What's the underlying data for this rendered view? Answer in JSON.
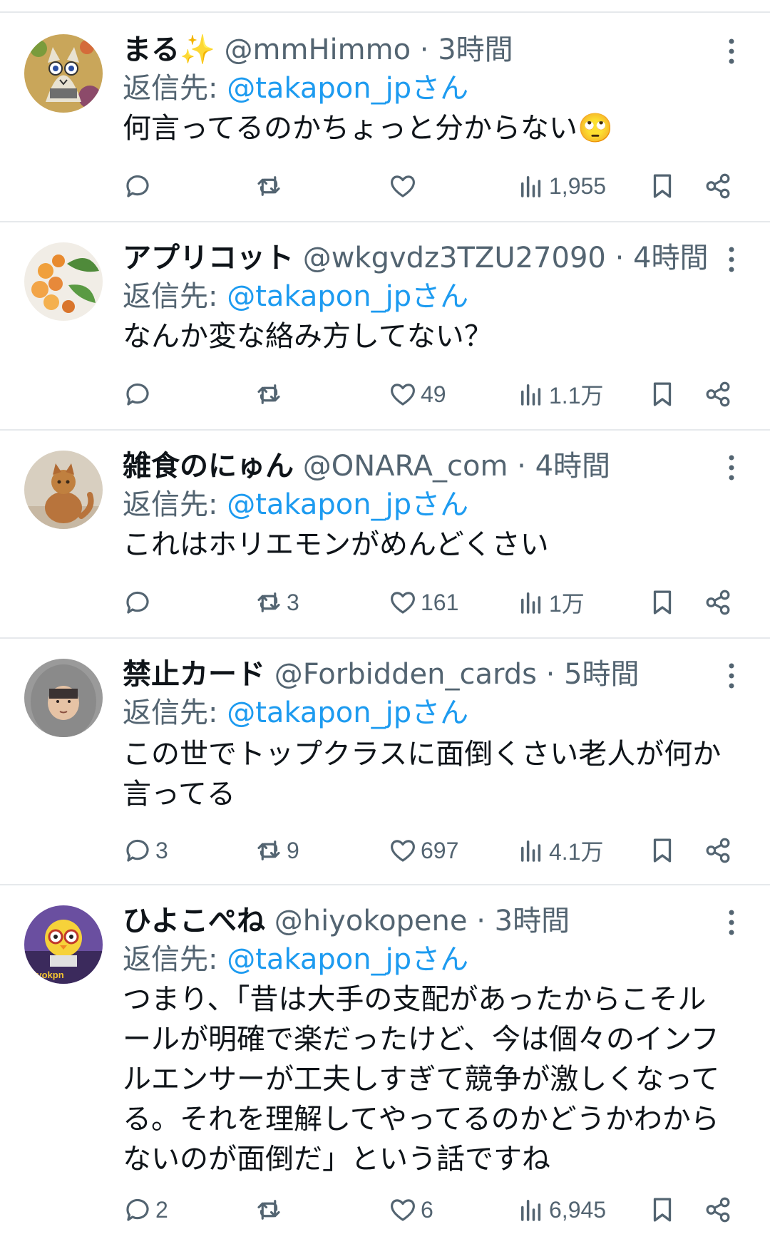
{
  "tweets": [
    {
      "name": "まる✨",
      "handle": "@mmHimmo",
      "sep": " · ",
      "time": "3時間",
      "reply_prefix": "返信先: ",
      "reply_target": "@takapon_jpさん",
      "text": "何言ってるのかちょっと分からない🙄",
      "replies": "",
      "retweets": "",
      "likes": "",
      "views": "1,955",
      "avatar": "cat-illustration-avatar"
    },
    {
      "name": "アプリコット",
      "handle": "@wkgvdz3TZU27090",
      "sep": " · ",
      "time": "4時間",
      "reply_prefix": "返信先: ",
      "reply_target": "@takapon_jpさん",
      "text": "なんか変な絡み方してない？",
      "replies": "",
      "retweets": "",
      "likes": "49",
      "views": "1.1万",
      "avatar": "apricot-photo-avatar"
    },
    {
      "name": "雑食のにゅん",
      "handle": "@ONARA_com",
      "sep": " · ",
      "time": "4時間",
      "reply_prefix": "返信先: ",
      "reply_target": "@takapon_jpさん",
      "text": "これはホリエモンがめんどくさい",
      "replies": "",
      "retweets": "3",
      "likes": "161",
      "views": "1万",
      "avatar": "cat-photo-avatar"
    },
    {
      "name": "禁止カード",
      "handle": "@Forbidden_cards",
      "sep": " · ",
      "time": "5時間",
      "reply_prefix": "返信先: ",
      "reply_target": "@takapon_jpさん",
      "text": "この世でトップクラスに面倒くさい老人が何か\n言ってる",
      "replies": "3",
      "retweets": "9",
      "likes": "697",
      "views": "4.1万",
      "avatar": "hooded-person-avatar"
    },
    {
      "name": "ひよこぺね",
      "handle": "@hiyokopene",
      "sep": " · ",
      "time": "3時間",
      "reply_prefix": "返信先: ",
      "reply_target": "@takapon_jpさん",
      "text": "つまり、「昔は大手の支配があったからこそル\nールが明確で楽だったけど、今は個々のインフ\nルエンサーが工夫しすぎて競争が激しくなって\nる。それを理解してやってるのかどうかわから\nないのが面倒だ」という話ですね",
      "replies": "2",
      "retweets": "",
      "likes": "6",
      "views": "6,945",
      "avatar": "chick-character-avatar",
      "avatar_text": "Hyokpn"
    }
  ],
  "colors": {
    "text": "#0f1419",
    "secondary": "#536471",
    "link": "#1d9bf0",
    "divider": "#e6e9ec"
  },
  "icons": [
    "reply-icon",
    "retweet-icon",
    "like-icon",
    "views-icon",
    "bookmark-icon",
    "share-icon",
    "more-icon"
  ]
}
